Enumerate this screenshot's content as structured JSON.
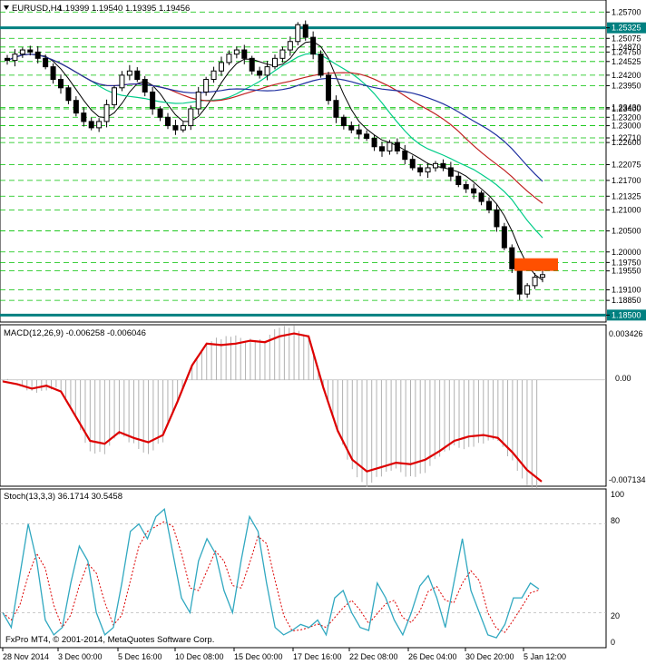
{
  "header": {
    "symbol": "EURUSD,H4",
    "ohlc": "1.19399 1.19540 1.19395 1.19456",
    "dropdown_icon": "triangle-down-icon"
  },
  "price_scale": {
    "labels": [
      "1.25700",
      "1.25325",
      "1.25075",
      "1.24870",
      "1.24750",
      "1.24525",
      "1.24200",
      "1.23950",
      "1.23430",
      "1.23400",
      "1.23200",
      "1.23000",
      "1.22710",
      "1.22600",
      "1.22075",
      "1.21700",
      "1.21325",
      "1.21000",
      "1.20500",
      "1.20000",
      "1.19750",
      "1.19550",
      "1.19100",
      "1.18850",
      "1.18500"
    ],
    "highlight_labels": [
      "1.25325",
      "1.18500"
    ]
  },
  "macd": {
    "title": "MACD(12,26,9) -0.006258 -0.006046",
    "scale": [
      "0.003426",
      "0.00",
      "-0.007134"
    ],
    "signal_color": "#dd0000",
    "hist_color": "#b0b0b0"
  },
  "stoch": {
    "title": "Stoch(13,3,3) 36.1714 30.5458",
    "scale": [
      "100",
      "80",
      "20",
      "0"
    ],
    "main_color": "#30a8c0",
    "signal_color": "#dd0000"
  },
  "time_axis": [
    "28 Nov 2014",
    "3 Dec 00:00",
    "5 Dec 16:00",
    "10 Dec 08:00",
    "15 Dec 00:00",
    "17 Dec 16:00",
    "22 Dec 08:00",
    "26 Dec 04:00",
    "30 Dec 20:00",
    "5 Jan 12:00"
  ],
  "copyright": "FxPro MT4, © 2001-2014, MetaQuotes Software Corp.",
  "colors": {
    "bull_candle": "#ffffff",
    "bear_candle": "#000000",
    "level_line": "#008080",
    "grid_dash": "#00c000",
    "ma_fast": "#000000",
    "ma_mid": "#00cc88",
    "ma_slow1": "#c02020",
    "ma_slow2": "#2030a0",
    "zone_fill": "#ff5000"
  },
  "chart_data": [
    {
      "type": "candlestick",
      "title": "EURUSD,H4",
      "ylim": [
        1.184,
        1.259
      ],
      "horizontal_levels": [
        1.25325,
        1.185
      ],
      "close_series": [
        1.2455,
        1.247,
        1.248,
        1.2475,
        1.246,
        1.244,
        1.241,
        1.239,
        1.236,
        1.233,
        1.231,
        1.2295,
        1.231,
        1.235,
        1.239,
        1.242,
        1.243,
        1.241,
        1.238,
        1.234,
        1.232,
        1.23,
        1.229,
        1.23,
        1.234,
        1.238,
        1.241,
        1.243,
        1.245,
        1.247,
        1.248,
        1.246,
        1.243,
        1.242,
        1.244,
        1.246,
        1.248,
        1.25,
        1.254,
        1.251,
        1.247,
        1.242,
        1.236,
        1.232,
        1.23,
        1.229,
        1.228,
        1.227,
        1.225,
        1.224,
        1.226,
        1.224,
        1.222,
        1.22,
        1.219,
        1.22,
        1.221,
        1.22,
        1.218,
        1.216,
        1.215,
        1.214,
        1.212,
        1.21,
        1.206,
        1.201,
        1.196,
        1.19,
        1.192,
        1.194,
        1.1946
      ]
    },
    {
      "type": "line",
      "title": "MACD(12,26,9)",
      "ylim": [
        -0.007134,
        0.003426
      ],
      "signal": [
        -0.0001,
        -0.0003,
        -0.0006,
        -0.0004,
        -0.0008,
        -0.0025,
        -0.0042,
        -0.0044,
        -0.0036,
        -0.004,
        -0.0043,
        -0.0038,
        -0.0015,
        0.001,
        0.0025,
        0.0024,
        0.0025,
        0.0027,
        0.0026,
        0.003,
        0.0032,
        0.003,
        -0.0005,
        -0.0035,
        -0.0055,
        -0.0063,
        -0.006,
        -0.0057,
        -0.0058,
        -0.0055,
        -0.0049,
        -0.0042,
        -0.0039,
        -0.0038,
        -0.004,
        -0.005,
        -0.0062,
        -0.007
      ]
    },
    {
      "type": "line",
      "title": "Stoch(13,3,3)",
      "ylim": [
        0,
        100
      ],
      "main": [
        20,
        10,
        45,
        80,
        55,
        15,
        5,
        10,
        40,
        65,
        55,
        20,
        5,
        10,
        40,
        75,
        80,
        70,
        85,
        90,
        60,
        30,
        20,
        55,
        70,
        60,
        35,
        20,
        55,
        85,
        75,
        40,
        10,
        5,
        8,
        12,
        10,
        15,
        5,
        30,
        35,
        20,
        10,
        8,
        40,
        30,
        15,
        5,
        20,
        38,
        45,
        30,
        10,
        40,
        70,
        35,
        20,
        5,
        3,
        12,
        30,
        30,
        40,
        36
      ]
    }
  ]
}
